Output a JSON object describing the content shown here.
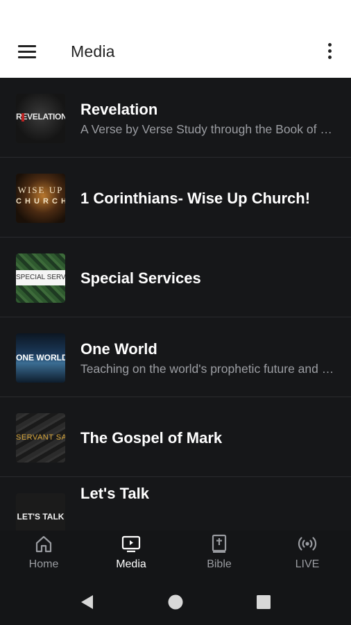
{
  "app_bar": {
    "title": "Media"
  },
  "items": [
    {
      "title": "Revelation",
      "subtitle": "A Verse by Verse Study through the Book of Revelation",
      "thumb_text": "REVELATION",
      "icon": "revelation-artwork"
    },
    {
      "title": "1 Corinthians- Wise Up Church!",
      "subtitle": "",
      "thumb_text": "WISE UP",
      "thumb_text2": "C H U R C H",
      "icon": "wise-up-artwork"
    },
    {
      "title": "Special Services",
      "subtitle": "",
      "thumb_text": "SPECIAL SERVICES",
      "icon": "special-services-artwork"
    },
    {
      "title": "One World",
      "subtitle": "Teaching on the world's prophetic future and more",
      "thumb_text": "ONE WORLD",
      "icon": "one-world-artwork"
    },
    {
      "title": "The Gospel of Mark",
      "subtitle": "",
      "thumb_text": "SERVANT SAVIOR",
      "icon": "servant-savior-artwork"
    },
    {
      "title": "Let's Talk",
      "subtitle": "",
      "thumb_text": "LET'S TALK",
      "icon": "lets-talk-artwork"
    }
  ],
  "bottom_nav": [
    {
      "label": "Home",
      "icon": "home-icon",
      "active": false
    },
    {
      "label": "Media",
      "icon": "tv-icon",
      "active": true
    },
    {
      "label": "Bible",
      "icon": "bible-icon",
      "active": false
    },
    {
      "label": "LIVE",
      "icon": "broadcast-icon",
      "active": false
    }
  ],
  "colors": {
    "background": "#161719",
    "app_bar": "#ffffff",
    "text_primary": "#ffffff",
    "text_secondary": "#9c9ea3"
  }
}
